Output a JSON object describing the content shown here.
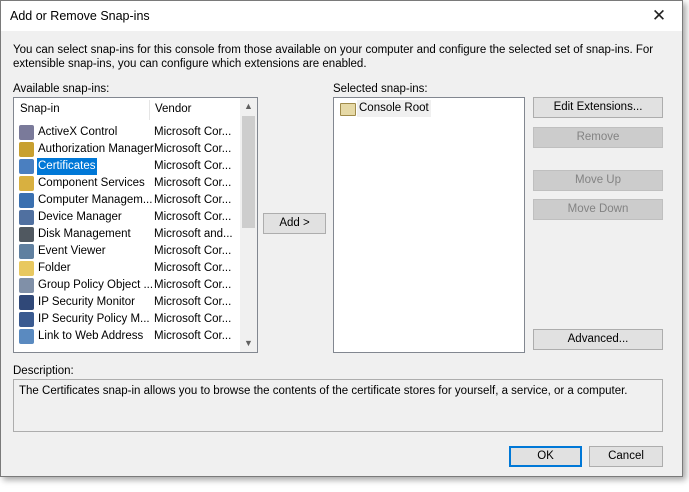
{
  "window": {
    "title": "Add or Remove Snap-ins",
    "close_glyph": "✕"
  },
  "intro_text": "You can select snap-ins for this console from those available on your computer and configure the selected set of snap-ins. For extensible snap-ins, you can configure which extensions are enabled.",
  "available": {
    "label": "Available snap-ins:",
    "columns": {
      "snapin": "Snap-in",
      "vendor": "Vendor"
    },
    "items": [
      {
        "name": "ActiveX Control",
        "vendor": "Microsoft Cor...",
        "icon": "activex-icon",
        "color": "#7a7a9a"
      },
      {
        "name": "Authorization Manager",
        "vendor": "Microsoft Cor...",
        "icon": "authorization-icon",
        "color": "#c8a030"
      },
      {
        "name": "Certificates",
        "vendor": "Microsoft Cor...",
        "icon": "certificate-icon",
        "color": "#4a7fc0"
      },
      {
        "name": "Component Services",
        "vendor": "Microsoft Cor...",
        "icon": "component-icon",
        "color": "#d8b040"
      },
      {
        "name": "Computer Managem...",
        "vendor": "Microsoft Cor...",
        "icon": "computer-icon",
        "color": "#3a70b0"
      },
      {
        "name": "Device Manager",
        "vendor": "Microsoft Cor...",
        "icon": "device-icon",
        "color": "#5070a0"
      },
      {
        "name": "Disk Management",
        "vendor": "Microsoft and...",
        "icon": "disk-icon",
        "color": "#505860"
      },
      {
        "name": "Event Viewer",
        "vendor": "Microsoft Cor...",
        "icon": "event-viewer-icon",
        "color": "#6080a0"
      },
      {
        "name": "Folder",
        "vendor": "Microsoft Cor...",
        "icon": "folder-icon",
        "color": "#e8c860"
      },
      {
        "name": "Group Policy Object ...",
        "vendor": "Microsoft Cor...",
        "icon": "policy-icon",
        "color": "#8090a8"
      },
      {
        "name": "IP Security Monitor",
        "vendor": "Microsoft Cor...",
        "icon": "ip-security-icon",
        "color": "#304878"
      },
      {
        "name": "IP Security Policy M...",
        "vendor": "Microsoft Cor...",
        "icon": "ip-policy-icon",
        "color": "#3a5a90"
      },
      {
        "name": "Link to Web Address",
        "vendor": "Microsoft Cor...",
        "icon": "web-link-icon",
        "color": "#5a8ac0"
      }
    ],
    "selected_index": 2
  },
  "add_button": "Add >",
  "selected": {
    "label": "Selected snap-ins:",
    "items": [
      {
        "name": "Console Root",
        "icon": "folder-icon"
      }
    ]
  },
  "buttons": {
    "edit_extensions": "Edit Extensions...",
    "remove": "Remove",
    "move_up": "Move Up",
    "move_down": "Move Down",
    "advanced": "Advanced...",
    "ok": "OK",
    "cancel": "Cancel"
  },
  "description": {
    "label": "Description:",
    "text": "The Certificates snap-in allows you to browse the contents of the certificate stores for yourself, a service, or a computer."
  },
  "colors": {
    "selection": "#0078d7",
    "dialog_bg": "#f0f0f0"
  }
}
